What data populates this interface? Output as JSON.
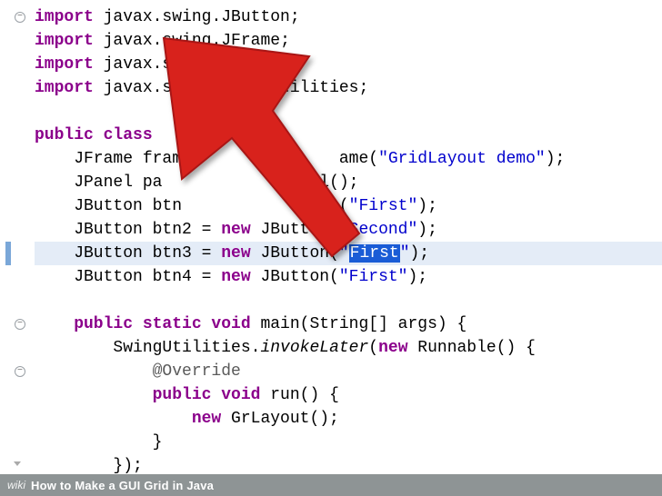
{
  "code": {
    "imports": [
      "javax.swing.JButton",
      "javax.swing.JFrame",
      "javax.swing.JPanel",
      "javax.swing.SwingUtilities"
    ],
    "class_decl": "public class ",
    "frame_line_prefix": "    JFrame frame",
    "frame_line_suffix": "ame(",
    "frame_str": "\"GridLayout demo\"",
    "panel_line_prefix": "    JPanel pa",
    "panel_line_suffix": "el();",
    "btn1_prefix": "    JButton btn",
    "btn1_suffix": "n(",
    "btn1_str": "\"First\"",
    "btn2_prefix": "    JButton btn2 = ",
    "btn2_new": "new",
    "btn2_mid": " JButton(",
    "btn2_str": "\"Second\"",
    "btn3_prefix": "    JButton btn3 = ",
    "btn3_mid": " JButton(",
    "btn3_str_open": "\"",
    "btn3_sel": "First",
    "btn3_str_close": "\"",
    "btn4_prefix": "    JButton btn4 = ",
    "btn4_mid": " JButton(",
    "btn4_str": "\"First\"",
    "main_sig_1": "    public static void",
    "main_sig_2": " main(String[] args) {",
    "invoke_1": "        SwingUtilities.",
    "invoke_ital": "invokeLater",
    "invoke_2": "(",
    "invoke_3": " Runnable() {",
    "override": "            @Override",
    "run_1": "            public void",
    "run_2": " run() {",
    "newgr_1": "                new",
    "newgr_2": " GrLayout();",
    "close1": "            }",
    "close2": "        });",
    "kw_import": "import",
    "kw_new": "new",
    "kw_public_class": "public class "
  },
  "footer": {
    "brand": "wiki",
    "title": "How to Make a GUI Grid in Java"
  }
}
